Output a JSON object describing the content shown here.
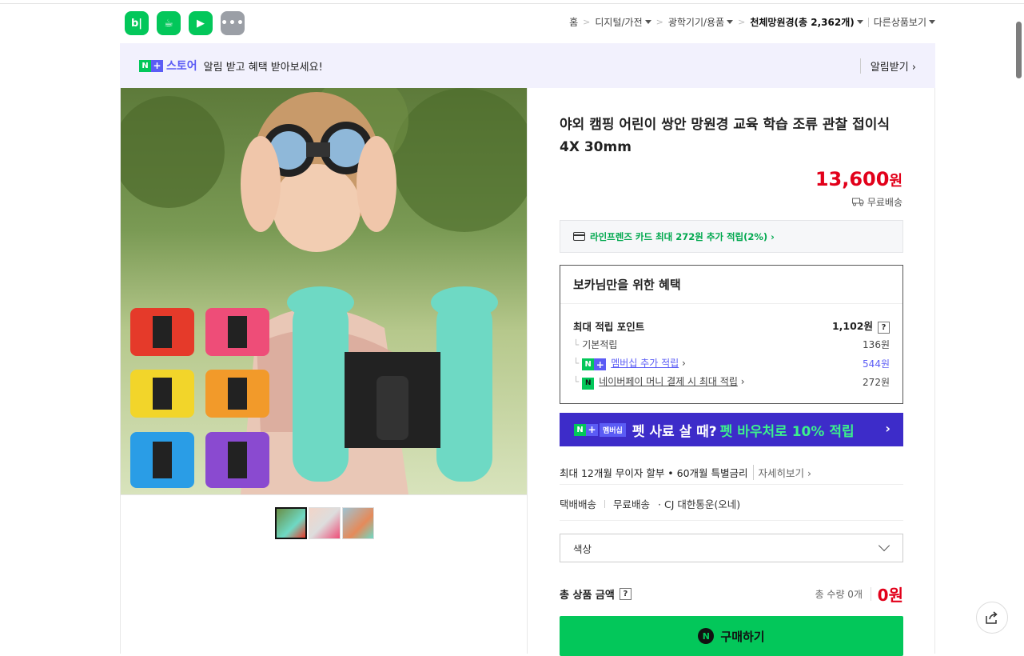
{
  "apps": [
    {
      "label": "b|",
      "name": "blog"
    },
    {
      "label": "☕",
      "name": "cafe"
    },
    {
      "label": "▶",
      "name": "place"
    },
    {
      "label": "•••",
      "name": "more"
    }
  ],
  "breadcrumb": {
    "home": "홈",
    "c1": "디지털/가전",
    "c2": "광학기기/용품",
    "c3": "천체망원경(총 ",
    "c3_count": "2,362",
    "c3_suffix": "개)",
    "other": "다른상품보기"
  },
  "banner": {
    "store": "스토어",
    "text": "알림 받고 혜택 받아보세요!",
    "action": "알림받기 ›"
  },
  "product": {
    "title": "야외 캠핑 어린이 쌍안 망원경 교육 학습 조류 관찰 접이식 4X 30mm",
    "price": "13,600",
    "price_unit": "원",
    "shipping": "무료배송",
    "card_benefit": "라인프렌즈 카드 최대 272원 추가 적립(2%) ›"
  },
  "benefit": {
    "title": "보카님만을 위한 혜택",
    "max_label": "최대 적립 포인트",
    "max_value": "1,102원",
    "q": "?",
    "basic_label": "기본적립",
    "basic_value": "136원",
    "membership_label": "멤버십 추가 적립",
    "membership_value": "544원",
    "npay_label": "네이버페이 머니 결제 시 최대 적립",
    "npay_value": "272원"
  },
  "ad": {
    "membership": "멤버십",
    "text": "펫 사료 살 때?",
    "highlight": "펫 바우처로 10% 적립",
    "arrow": "›"
  },
  "installment": {
    "text": "최대 12개월 무이자 할부 • 60개월 특별금리",
    "more": "자세히보기 ›"
  },
  "delivery": {
    "type": "택배배송",
    "fee": "무료배송",
    "courier": "· CJ 대한통운(오네)"
  },
  "option": {
    "placeholder": "색상"
  },
  "total": {
    "label": "총 상품 금액",
    "qty": "총 수량 0개",
    "amount": "0원"
  },
  "buy": {
    "label": "구매하기"
  },
  "colors": {
    "green": "#03c75a",
    "purple": "#5b5cf5",
    "red": "#e2001a",
    "adbg": "#3d2cc9"
  }
}
